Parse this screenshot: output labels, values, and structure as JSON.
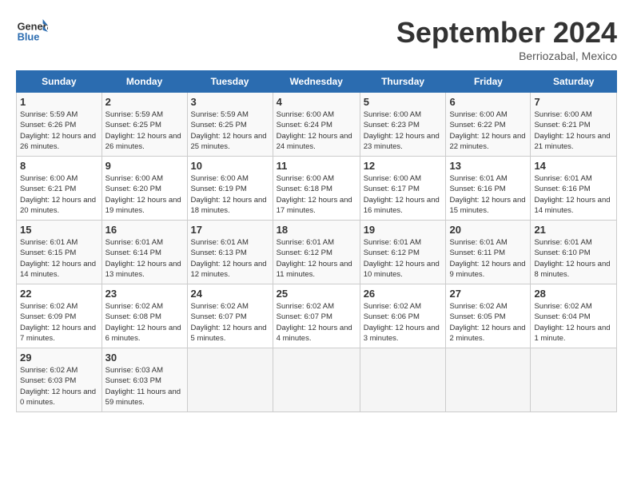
{
  "header": {
    "logo_text_general": "General",
    "logo_text_blue": "Blue",
    "month_title": "September 2024",
    "location": "Berriozabal, Mexico"
  },
  "days_of_week": [
    "Sunday",
    "Monday",
    "Tuesday",
    "Wednesday",
    "Thursday",
    "Friday",
    "Saturday"
  ],
  "weeks": [
    [
      {
        "day": "1",
        "sunrise": "Sunrise: 5:59 AM",
        "sunset": "Sunset: 6:26 PM",
        "daylight": "Daylight: 12 hours and 26 minutes."
      },
      {
        "day": "2",
        "sunrise": "Sunrise: 5:59 AM",
        "sunset": "Sunset: 6:25 PM",
        "daylight": "Daylight: 12 hours and 26 minutes."
      },
      {
        "day": "3",
        "sunrise": "Sunrise: 5:59 AM",
        "sunset": "Sunset: 6:25 PM",
        "daylight": "Daylight: 12 hours and 25 minutes."
      },
      {
        "day": "4",
        "sunrise": "Sunrise: 6:00 AM",
        "sunset": "Sunset: 6:24 PM",
        "daylight": "Daylight: 12 hours and 24 minutes."
      },
      {
        "day": "5",
        "sunrise": "Sunrise: 6:00 AM",
        "sunset": "Sunset: 6:23 PM",
        "daylight": "Daylight: 12 hours and 23 minutes."
      },
      {
        "day": "6",
        "sunrise": "Sunrise: 6:00 AM",
        "sunset": "Sunset: 6:22 PM",
        "daylight": "Daylight: 12 hours and 22 minutes."
      },
      {
        "day": "7",
        "sunrise": "Sunrise: 6:00 AM",
        "sunset": "Sunset: 6:21 PM",
        "daylight": "Daylight: 12 hours and 21 minutes."
      }
    ],
    [
      {
        "day": "8",
        "sunrise": "Sunrise: 6:00 AM",
        "sunset": "Sunset: 6:21 PM",
        "daylight": "Daylight: 12 hours and 20 minutes."
      },
      {
        "day": "9",
        "sunrise": "Sunrise: 6:00 AM",
        "sunset": "Sunset: 6:20 PM",
        "daylight": "Daylight: 12 hours and 19 minutes."
      },
      {
        "day": "10",
        "sunrise": "Sunrise: 6:00 AM",
        "sunset": "Sunset: 6:19 PM",
        "daylight": "Daylight: 12 hours and 18 minutes."
      },
      {
        "day": "11",
        "sunrise": "Sunrise: 6:00 AM",
        "sunset": "Sunset: 6:18 PM",
        "daylight": "Daylight: 12 hours and 17 minutes."
      },
      {
        "day": "12",
        "sunrise": "Sunrise: 6:00 AM",
        "sunset": "Sunset: 6:17 PM",
        "daylight": "Daylight: 12 hours and 16 minutes."
      },
      {
        "day": "13",
        "sunrise": "Sunrise: 6:01 AM",
        "sunset": "Sunset: 6:16 PM",
        "daylight": "Daylight: 12 hours and 15 minutes."
      },
      {
        "day": "14",
        "sunrise": "Sunrise: 6:01 AM",
        "sunset": "Sunset: 6:16 PM",
        "daylight": "Daylight: 12 hours and 14 minutes."
      }
    ],
    [
      {
        "day": "15",
        "sunrise": "Sunrise: 6:01 AM",
        "sunset": "Sunset: 6:15 PM",
        "daylight": "Daylight: 12 hours and 14 minutes."
      },
      {
        "day": "16",
        "sunrise": "Sunrise: 6:01 AM",
        "sunset": "Sunset: 6:14 PM",
        "daylight": "Daylight: 12 hours and 13 minutes."
      },
      {
        "day": "17",
        "sunrise": "Sunrise: 6:01 AM",
        "sunset": "Sunset: 6:13 PM",
        "daylight": "Daylight: 12 hours and 12 minutes."
      },
      {
        "day": "18",
        "sunrise": "Sunrise: 6:01 AM",
        "sunset": "Sunset: 6:12 PM",
        "daylight": "Daylight: 12 hours and 11 minutes."
      },
      {
        "day": "19",
        "sunrise": "Sunrise: 6:01 AM",
        "sunset": "Sunset: 6:12 PM",
        "daylight": "Daylight: 12 hours and 10 minutes."
      },
      {
        "day": "20",
        "sunrise": "Sunrise: 6:01 AM",
        "sunset": "Sunset: 6:11 PM",
        "daylight": "Daylight: 12 hours and 9 minutes."
      },
      {
        "day": "21",
        "sunrise": "Sunrise: 6:01 AM",
        "sunset": "Sunset: 6:10 PM",
        "daylight": "Daylight: 12 hours and 8 minutes."
      }
    ],
    [
      {
        "day": "22",
        "sunrise": "Sunrise: 6:02 AM",
        "sunset": "Sunset: 6:09 PM",
        "daylight": "Daylight: 12 hours and 7 minutes."
      },
      {
        "day": "23",
        "sunrise": "Sunrise: 6:02 AM",
        "sunset": "Sunset: 6:08 PM",
        "daylight": "Daylight: 12 hours and 6 minutes."
      },
      {
        "day": "24",
        "sunrise": "Sunrise: 6:02 AM",
        "sunset": "Sunset: 6:07 PM",
        "daylight": "Daylight: 12 hours and 5 minutes."
      },
      {
        "day": "25",
        "sunrise": "Sunrise: 6:02 AM",
        "sunset": "Sunset: 6:07 PM",
        "daylight": "Daylight: 12 hours and 4 minutes."
      },
      {
        "day": "26",
        "sunrise": "Sunrise: 6:02 AM",
        "sunset": "Sunset: 6:06 PM",
        "daylight": "Daylight: 12 hours and 3 minutes."
      },
      {
        "day": "27",
        "sunrise": "Sunrise: 6:02 AM",
        "sunset": "Sunset: 6:05 PM",
        "daylight": "Daylight: 12 hours and 2 minutes."
      },
      {
        "day": "28",
        "sunrise": "Sunrise: 6:02 AM",
        "sunset": "Sunset: 6:04 PM",
        "daylight": "Daylight: 12 hours and 1 minute."
      }
    ],
    [
      {
        "day": "29",
        "sunrise": "Sunrise: 6:02 AM",
        "sunset": "Sunset: 6:03 PM",
        "daylight": "Daylight: 12 hours and 0 minutes."
      },
      {
        "day": "30",
        "sunrise": "Sunrise: 6:03 AM",
        "sunset": "Sunset: 6:03 PM",
        "daylight": "Daylight: 11 hours and 59 minutes."
      },
      null,
      null,
      null,
      null,
      null
    ]
  ]
}
